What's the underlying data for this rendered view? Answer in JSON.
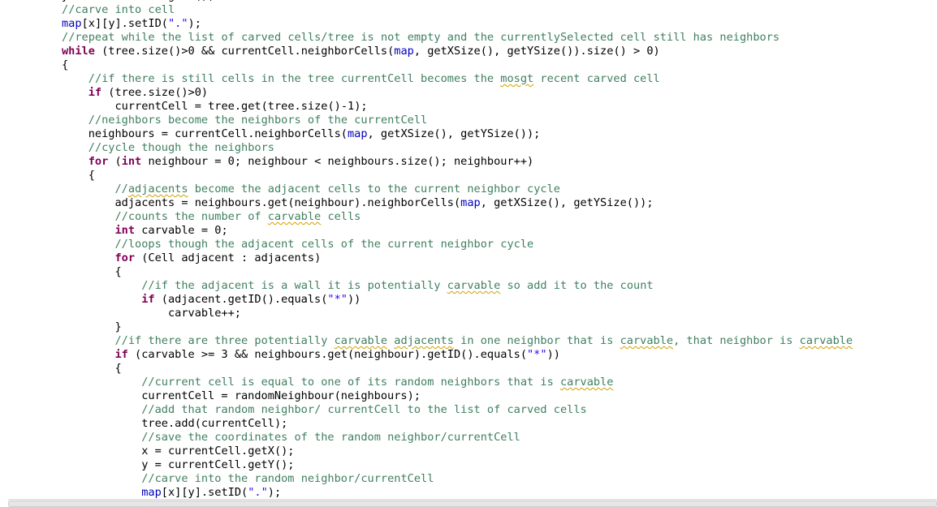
{
  "editor": {
    "lines": [
      {
        "indent": "",
        "text": "y = currentCell.getY();",
        "kind": "code"
      },
      {
        "indent": "",
        "text": "//carve into cell",
        "kind": "comment"
      },
      {
        "indent": "",
        "text": "map[x][y].setID(\".\");",
        "kind": "code"
      },
      {
        "indent": "",
        "text": "//repeat while the list of carved cells/tree is not empty and the currentlySelected cell still has neighbors",
        "kind": "comment"
      },
      {
        "indent": "",
        "text": "while (tree.size()>0 && currentCell.neighborCells(map, getXSize(), getYSize()).size() > 0)",
        "kind": "code"
      },
      {
        "indent": "",
        "text": "{",
        "kind": "code"
      },
      {
        "indent": "    ",
        "text": "//if there is still cells in the tree currentCell becomes the mosgt recent carved cell",
        "kind": "comment"
      },
      {
        "indent": "    ",
        "text": "if (tree.size()>0)",
        "kind": "code"
      },
      {
        "indent": "        ",
        "text": "currentCell = tree.get(tree.size()-1);",
        "kind": "code"
      },
      {
        "indent": "    ",
        "text": "//neighbors become the neighbors of the currentCell",
        "kind": "comment"
      },
      {
        "indent": "    ",
        "text": "neighbours = currentCell.neighborCells(map, getXSize(), getYSize());",
        "kind": "code"
      },
      {
        "indent": "    ",
        "text": "//cycle though the neighbors",
        "kind": "comment"
      },
      {
        "indent": "    ",
        "text": "for (int neighbour = 0; neighbour < neighbours.size(); neighbour++)",
        "kind": "code"
      },
      {
        "indent": "    ",
        "text": "{",
        "kind": "code"
      },
      {
        "indent": "        ",
        "text": "//adjacents become the adjacent cells to the current neighbor cycle",
        "kind": "comment"
      },
      {
        "indent": "        ",
        "text": "adjacents = neighbours.get(neighbour).neighborCells(map, getXSize(), getYSize());",
        "kind": "code"
      },
      {
        "indent": "        ",
        "text": "//counts the number of carvable cells",
        "kind": "comment"
      },
      {
        "indent": "        ",
        "text": "int carvable = 0;",
        "kind": "code"
      },
      {
        "indent": "        ",
        "text": "//loops though the adjacent cells of the current neighbor cycle",
        "kind": "comment"
      },
      {
        "indent": "        ",
        "text": "for (Cell adjacent : adjacents)",
        "kind": "code"
      },
      {
        "indent": "        ",
        "text": "{",
        "kind": "code"
      },
      {
        "indent": "            ",
        "text": "//if the adjacent is a wall it is potentially carvable so add it to the count",
        "kind": "comment"
      },
      {
        "indent": "            ",
        "text": "if (adjacent.getID().equals(\"*\"))",
        "kind": "code"
      },
      {
        "indent": "                ",
        "text": "carvable++;",
        "kind": "code"
      },
      {
        "indent": "        ",
        "text": "}",
        "kind": "code"
      },
      {
        "indent": "        ",
        "text": "//if there are three potentially carvable adjacents in one neighbor that is carvable, that neighbor is carvable",
        "kind": "comment"
      },
      {
        "indent": "        ",
        "text": "if (carvable >= 3 && neighbours.get(neighbour).getID().equals(\"*\"))",
        "kind": "code"
      },
      {
        "indent": "        ",
        "text": "{",
        "kind": "code"
      },
      {
        "indent": "            ",
        "text": "//current cell is equal to one of its random neighbors that is carvable",
        "kind": "comment"
      },
      {
        "indent": "            ",
        "text": "currentCell = randomNeighbour(neighbours);",
        "kind": "code"
      },
      {
        "indent": "            ",
        "text": "//add that random neighbor/ currentCell to the list of carved cells",
        "kind": "comment"
      },
      {
        "indent": "            ",
        "text": "tree.add(currentCell);",
        "kind": "code"
      },
      {
        "indent": "            ",
        "text": "//save the coordinates of the random neighbor/currentCell",
        "kind": "comment"
      },
      {
        "indent": "            ",
        "text": "x = currentCell.getX();",
        "kind": "code"
      },
      {
        "indent": "            ",
        "text": "y = currentCell.getY();",
        "kind": "code"
      },
      {
        "indent": "            ",
        "text": "//carve into the random neighbor/currentCell",
        "kind": "comment"
      },
      {
        "indent": "            ",
        "text": "map[x][y].setID(\".\");",
        "kind": "code"
      }
    ],
    "keywords": [
      "while",
      "if",
      "for",
      "int"
    ],
    "fields": [
      "map"
    ],
    "misspelled": [
      "mosgt",
      "adjacents",
      "carvable"
    ],
    "colors": {
      "comment": "#3f7f5f",
      "keyword": "#7f0055",
      "field": "#0000c0",
      "string": "#2a00ff",
      "spelling": "#d0a000"
    }
  }
}
